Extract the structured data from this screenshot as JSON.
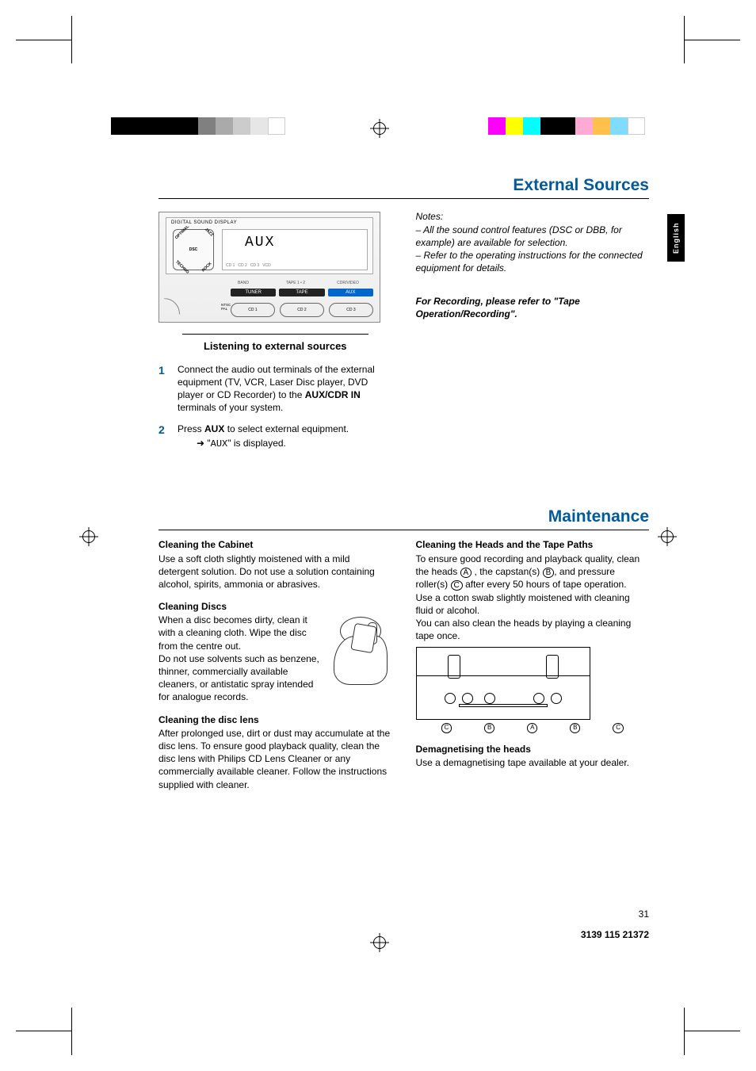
{
  "sidebar_lang": "English",
  "page_number": "31",
  "doc_number": "3139 115 21372",
  "ext_sources": {
    "title": "External Sources",
    "figure": {
      "dsd": "DIGITAL SOUND DISPLAY",
      "dsc": "DSC",
      "optimal": "OPTIMAL",
      "jazz": "JAZZ",
      "techno": "TECHNO",
      "rock": "ROCK",
      "aux_seg": "AUX",
      "band": "BAND",
      "tape12": "TAPE 1 • 2",
      "cdrvideo": "CDR/VIDEO",
      "tuner": "TUNER",
      "tape": "TAPE",
      "aux_btn": "AUX",
      "ntsc": "NTSC",
      "pal": "PAL",
      "cd1": "CD 1",
      "cd2": "CD 2",
      "cd3": "CD 3",
      "vcd": "VCD"
    },
    "sub_heading": "Listening to external sources",
    "step1": "Connect the audio out terminals of the external equipment (TV, VCR, Laser Disc player, DVD player or CD Recorder) to the ",
    "step1_bold": "AUX/CDR IN",
    "step1_after": " terminals of your system.",
    "step2_a": "Press ",
    "step2_bold": "AUX",
    "step2_b": " to select external equipment.",
    "step2_line2_a": "\"",
    "step2_line2_seg": "AUX",
    "step2_line2_b": "\" is displayed.",
    "notes_label": "Notes:",
    "note1": "–  All the sound control features (DSC or DBB, for example) are available for selection.",
    "note2": "–  Refer to the operating instructions for the connected equipment for details.",
    "recording_note": "For Recording, please refer to \"Tape Operation/Recording\"."
  },
  "maintenance": {
    "title": "Maintenance",
    "cabinet_h": "Cleaning the Cabinet",
    "cabinet_p": "Use a soft cloth slightly moistened with a mild detergent solution. Do not use a solution containing alcohol, spirits, ammonia or abrasives.",
    "discs_h": "Cleaning Discs",
    "discs_p1": "When a disc becomes dirty, clean it with a cleaning cloth. Wipe the disc from the centre out.",
    "discs_p2": "Do not use solvents such as benzene, thinner, commercially available cleaners, or antistatic spray intended for analogue records.",
    "lens_h": "Cleaning the disc lens",
    "lens_p": "After prolonged use, dirt or dust may accumulate at the disc lens. To ensure good playback quality, clean the disc lens with Philips CD Lens Cleaner or any commercially available cleaner. Follow the instructions supplied with cleaner.",
    "heads_h": "Cleaning the Heads and the Tape Paths",
    "heads_p1a": "To ensure good recording and playback quality, clean the heads ",
    "heads_A": "A",
    "heads_p1b": " , the capstan(s) ",
    "heads_B": "B",
    "heads_p1c": ", and pressure roller(s) ",
    "heads_C": "C",
    "heads_p1d": " after every 50 hours of tape operation.",
    "heads_p2": "Use a cotton swab slightly moistened with cleaning fluid or alcohol.",
    "heads_p3": "You can also clean the heads by playing a cleaning tape once.",
    "heads_labels": {
      "c": "C",
      "b": "B",
      "a": "A",
      "b2": "B",
      "c2": "C"
    },
    "demag_h": "Demagnetising the heads",
    "demag_p": "Use a demagnetising tape available at your dealer."
  },
  "colors": {
    "left_bar": [
      "#000000",
      "#000000",
      "#000000",
      "#000000",
      "#000000",
      "#808080",
      "#aaaaaa",
      "#cccccc",
      "#e6e6e6",
      "#ffffff"
    ],
    "right_bar": [
      "#ff00ff",
      "#ffff00",
      "#00ffff",
      "#000000",
      "#000000",
      "#ffaad4",
      "#ffc04c",
      "#7fdcff",
      "#ffffff"
    ]
  }
}
